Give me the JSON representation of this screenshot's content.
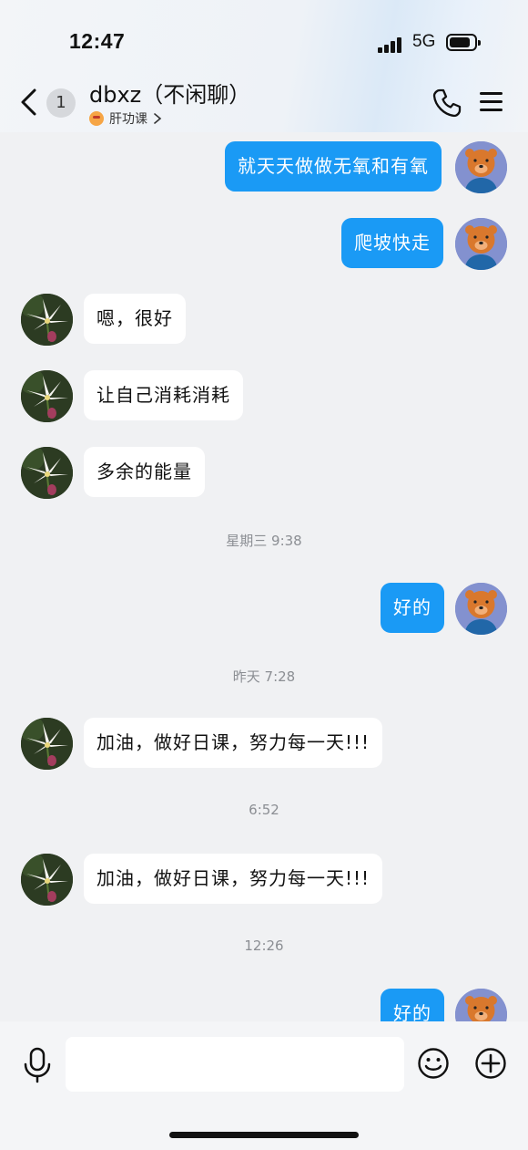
{
  "status_bar": {
    "time": "12:47",
    "network": "5G"
  },
  "header": {
    "unread_count": "1",
    "title": "dbxz（不闲聊）",
    "subtitle": "肝功课"
  },
  "messages": [
    {
      "side": "out",
      "text": "就天天做做无氧和有氧"
    },
    {
      "side": "out",
      "text": "爬坡快走"
    },
    {
      "side": "in",
      "text": "嗯，很好"
    },
    {
      "side": "in",
      "text": "让自己消耗消耗"
    },
    {
      "side": "in",
      "text": "多余的能量"
    },
    {
      "timestamp": "星期三 9:38"
    },
    {
      "side": "out",
      "text": "好的"
    },
    {
      "timestamp": "昨天 7:28"
    },
    {
      "side": "in",
      "text": "加油，做好日课，努力每一天!!!"
    },
    {
      "timestamp": "6:52"
    },
    {
      "side": "in",
      "text": "加油，做好日课，努力每一天!!!"
    },
    {
      "timestamp": "12:26"
    },
    {
      "side": "out",
      "text": "好的"
    }
  ],
  "input": {
    "placeholder": ""
  },
  "colors": {
    "outgoing_bubble": "#1a9af5",
    "incoming_bubble": "#ffffff",
    "background": "#f0f1f3"
  },
  "icons": [
    "back-arrow-icon",
    "phone-icon",
    "menu-icon",
    "microphone-icon",
    "emoji-icon",
    "plus-icon"
  ]
}
